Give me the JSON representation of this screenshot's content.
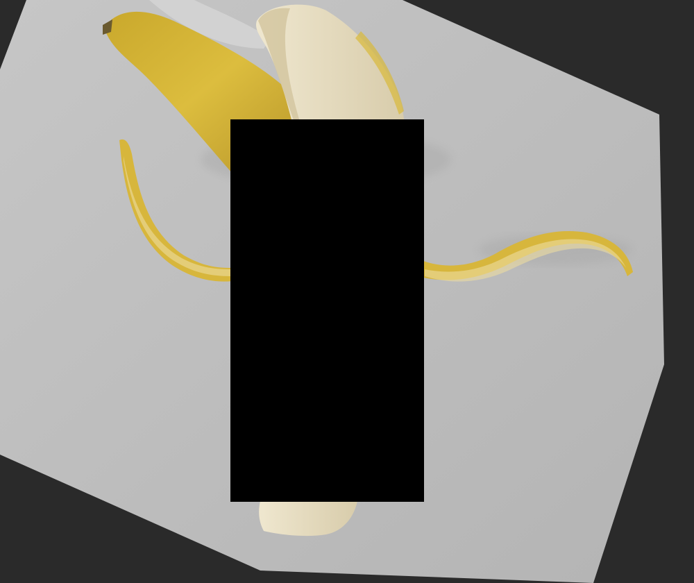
{
  "scene": {
    "subject": "peeled-banana-photo",
    "colors": {
      "outer_background": "#2a2a2a",
      "photo_background": "#bdbdbd",
      "banana_skin": "#d9b93a",
      "banana_skin_shadow": "#b89a2a",
      "banana_flesh": "#e6dcc2",
      "banana_flesh_shadow": "#cfc4a6",
      "redaction_block": "#000000"
    }
  }
}
